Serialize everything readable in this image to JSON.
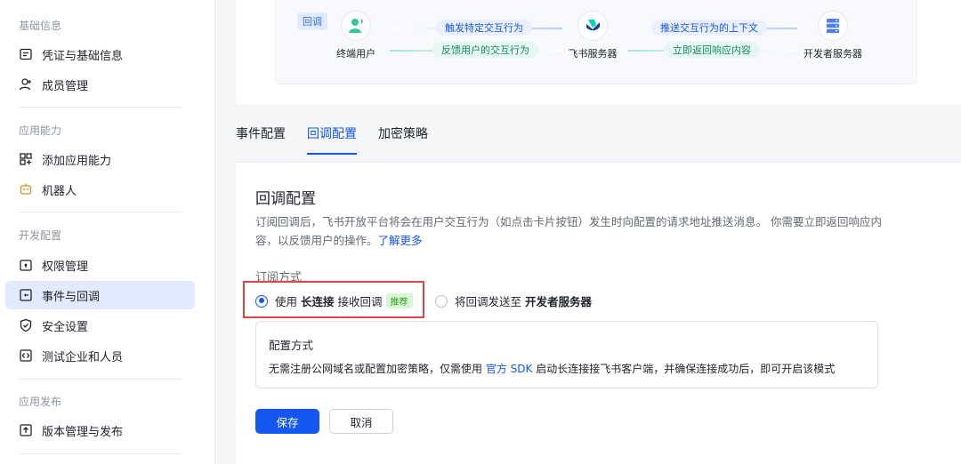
{
  "sidebar": {
    "sections": [
      {
        "title": "基础信息",
        "items": [
          {
            "label": "凭证与基础信息",
            "icon": "id-card-icon"
          },
          {
            "label": "成员管理",
            "icon": "user-add-icon"
          }
        ]
      },
      {
        "title": "应用能力",
        "items": [
          {
            "label": "添加应用能力",
            "icon": "grid-add-icon"
          },
          {
            "label": "机器人",
            "icon": "robot-icon"
          }
        ]
      },
      {
        "title": "开发配置",
        "items": [
          {
            "label": "权限管理",
            "icon": "lock-box-icon"
          },
          {
            "label": "事件与回调",
            "icon": "event-box-icon",
            "active": true
          },
          {
            "label": "安全设置",
            "icon": "shield-check-icon"
          },
          {
            "label": "测试企业和人员",
            "icon": "code-box-icon"
          }
        ]
      },
      {
        "title": "应用发布",
        "items": [
          {
            "label": "版本管理与发布",
            "icon": "upload-box-icon"
          }
        ]
      }
    ]
  },
  "diagram": {
    "tag": "回调",
    "nodes": {
      "user": "终端用户",
      "feishu": "飞书服务器",
      "developer": "开发者服务器"
    },
    "flows": {
      "user_to_feishu": "触发特定交互行为",
      "feishu_to_user": "反馈用户的交互行为",
      "feishu_to_dev": "推送交互行为的上下文",
      "dev_to_feishu": "立即返回响应内容"
    }
  },
  "tabs": [
    {
      "label": "事件配置",
      "active": false
    },
    {
      "label": "回调配置",
      "active": true
    },
    {
      "label": "加密策略",
      "active": false
    }
  ],
  "panel": {
    "title": "回调配置",
    "desc_line1": "订阅回调后，飞书开放平台将会在用户交互行为（如点击卡片按钮）发生时向配置的请求地址推送消息。 你需要立即返回响应内",
    "desc_line2": "容，以反馈用户的操作。",
    "desc_link": "了解更多",
    "subscribe_label": "订阅方式",
    "option1": {
      "prefix": "使用",
      "bold": "长连接",
      "suffix": "接收回调",
      "badge": "推荐",
      "checked": true
    },
    "option2": {
      "prefix": "将回调发送至",
      "bold": "开发者服务器",
      "checked": false
    },
    "config_box": {
      "title": "配置方式",
      "text_before": "无需注册公网域名或配置加密策略，仅需使用 ",
      "link": "官方 SDK",
      "text_after": " 启动长连接接飞书客户端，并确保连接成功后，即可开启该模式"
    },
    "save_label": "保存",
    "cancel_label": "取消"
  },
  "colors": {
    "accent": "#1456f0",
    "highlight_border": "#e04545",
    "badge_bg": "#d9f5d6",
    "badge_text": "#2ea121"
  }
}
